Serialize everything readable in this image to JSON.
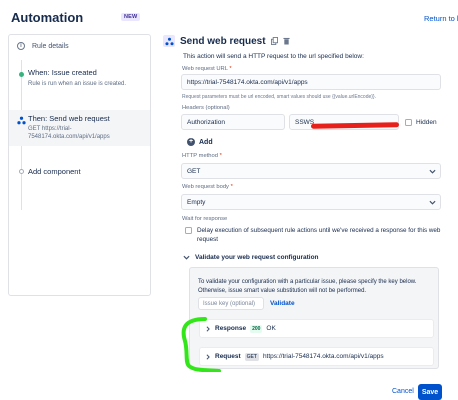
{
  "header": {
    "title": "Automation",
    "badge": "NEW",
    "return_link": "Return to li"
  },
  "rule_panel": {
    "rule_details": "Rule details",
    "trigger": {
      "title": "When: Issue created",
      "subtitle": "Rule is run when an issue is created."
    },
    "action": {
      "title": "Then: Send web request",
      "subtitle_1": "GET https://trial-",
      "subtitle_2": "7548174.okta.com/api/v1/apps"
    },
    "add_component": "Add component"
  },
  "main": {
    "title": "Send web request",
    "description": "This action will send a HTTP request to the url specified below:",
    "url_label": "Web request URL",
    "url_value": "https://trial-7548174.okta.com/api/v1/apps",
    "url_help": "Request parameters must be url encoded, smart values should use {{value.urlEncode}}.",
    "headers_label": "Headers (optional)",
    "header_key": "Authorization",
    "header_value": "SSWS",
    "hidden_label": "Hidden",
    "add_label": "Add",
    "method_label": "HTTP method",
    "method_value": "GET",
    "body_label": "Web request body",
    "body_value": "Empty",
    "wait_label": "Wait for response",
    "delay_text": "Delay execution of subsequent rule actions until we've received a response for this web request",
    "validate_header": "Validate your web request configuration",
    "validate_text": "To validate your configuration with a particular issue, please specify the key below. Otherwise, issue smart value substitution will not be performed.",
    "issue_key_placeholder": "Issue key (optional)",
    "validate_button": "Validate",
    "response_label": "Response",
    "response_code": "200",
    "response_status": "OK",
    "request_label": "Request",
    "request_method": "GET",
    "request_url": "https://trial-7548174.okta.com/api/v1/apps"
  },
  "footer": {
    "cancel": "Cancel",
    "save": "Save"
  },
  "colors": {
    "accent": "#0052cc",
    "success": "#36b37e",
    "redaction": "#e8201b",
    "annotation": "#33e61a"
  }
}
